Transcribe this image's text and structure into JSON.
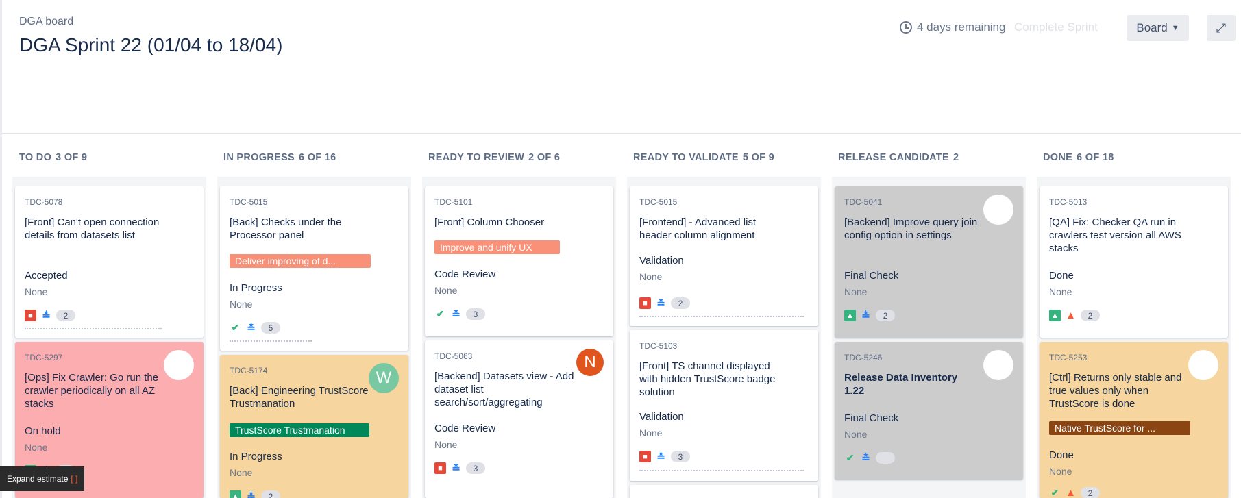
{
  "header": {
    "board_name": "DGA board",
    "sprint_title": "DGA Sprint 22 (01/04 to 18/04)",
    "remaining": "4 days remaining",
    "complete_sprint": "Complete Sprint",
    "board_select": "Board",
    "icons": {
      "clock": "clock-icon",
      "chevron": "chevron-down-icon",
      "expand": "expand-icon"
    }
  },
  "columns": [
    {
      "name": "TO DO",
      "count": "3 OF 9",
      "cards": [
        {
          "key": "TDC-5078",
          "summary": "[Front] Can't open connection details from datasets list",
          "status": "Accepted",
          "assignee": "None",
          "type": "bug",
          "priority": "low",
          "estimate": "2",
          "color": "#ffffff"
        },
        {
          "key": "TDC-5297",
          "summary": "[Ops] Fix Crawler: Go run the crawler periodically on all AZ stacks",
          "status": "On hold",
          "assignee": "None",
          "type": "story",
          "priority": "low",
          "estimate": "2",
          "color": "#fbadaf",
          "avatar": ""
        }
      ]
    },
    {
      "name": "IN PROGRESS",
      "count": "6 OF 16",
      "cards": [
        {
          "key": "TDC-5015",
          "summary": "[Back] Checks under the Processor panel",
          "epic": "Deliver improving of d...",
          "epic_color": "#f99178",
          "status": "In Progress",
          "assignee": "None",
          "type": "task",
          "priority": "low",
          "estimate": "5",
          "color": "#ffffff"
        },
        {
          "key": "TDC-5174",
          "summary": "[Back] Engineering TrustScore Trustmanation",
          "epic": "TrustScore Trustmanation",
          "epic_color": "#00875a",
          "status": "In Progress",
          "assignee": "None",
          "type": "story",
          "priority": "low",
          "estimate": "2",
          "color": "#f6d69e",
          "avatar": "W"
        }
      ]
    },
    {
      "name": "READY TO REVIEW",
      "count": "2 OF 6",
      "cards": [
        {
          "key": "TDC-5101",
          "summary": "[Front] Column Chooser",
          "epic": "Improve and unify UX",
          "epic_color": "#f99178",
          "status": "Code Review",
          "assignee": "None",
          "type": "task",
          "priority": "low",
          "estimate": "3",
          "color": "#ffffff"
        },
        {
          "key": "TDC-5063",
          "summary": "[Backend] Datasets view - Add dataset list search/sort/aggregating",
          "status": "Code Review",
          "assignee": "None",
          "type": "bug",
          "priority": "low",
          "estimate": "3",
          "color": "#ffffff",
          "avatar": "N"
        }
      ]
    },
    {
      "name": "READY TO VALIDATE",
      "count": "5 OF 9",
      "cards": [
        {
          "key": "TDC-5015",
          "summary": "[Frontend] - Advanced list header column alignment",
          "status": "Validation",
          "assignee": "None",
          "type": "bug",
          "priority": "low",
          "estimate": "2",
          "color": "#ffffff"
        },
        {
          "key": "TDC-5103",
          "summary": "[Front] TS channel displayed with hidden TrustScore badge solution",
          "status": "Validation",
          "assignee": "None",
          "type": "bug",
          "priority": "low",
          "estimate": "3",
          "color": "#ffffff"
        }
      ]
    },
    {
      "name": "RELEASE CANDIDATE",
      "count": "2",
      "cards": [
        {
          "key": "TDC-5041",
          "summary": "[Backend] Improve query join config option in settings",
          "status": "Final Check",
          "assignee": "None",
          "type": "story",
          "priority": "low",
          "estimate": "2",
          "color": "#cccccc",
          "avatar": ""
        },
        {
          "key": "TDC-5246",
          "summary": "Release Data Inventory 1.22",
          "status": "Final Check",
          "assignee": "None",
          "type": "task",
          "priority": "low",
          "estimate": "",
          "color": "#cccccc",
          "avatar": ""
        }
      ]
    },
    {
      "name": "DONE",
      "count": "6 OF 18",
      "cards": [
        {
          "key": "TDC-5013",
          "summary": "[QA] Fix: Checker QA run in crawlers test version all AWS stacks",
          "status": "Done",
          "assignee": "None",
          "type": "story",
          "priority": "high",
          "estimate": "2",
          "color": "#ffffff"
        },
        {
          "key": "TDC-5253",
          "summary": "[Ctrl] Returns only stable and true values only when TrustScore is done",
          "epic": "Native TrustScore for ...",
          "epic_color": "#8b4513",
          "status": "Done",
          "assignee": "None",
          "type": "task",
          "priority": "high",
          "estimate": "2",
          "color": "#f6d69e",
          "avatar": ""
        }
      ]
    }
  ],
  "tooltip": {
    "text": "Expand estimate",
    "suffix": "[ ]"
  }
}
